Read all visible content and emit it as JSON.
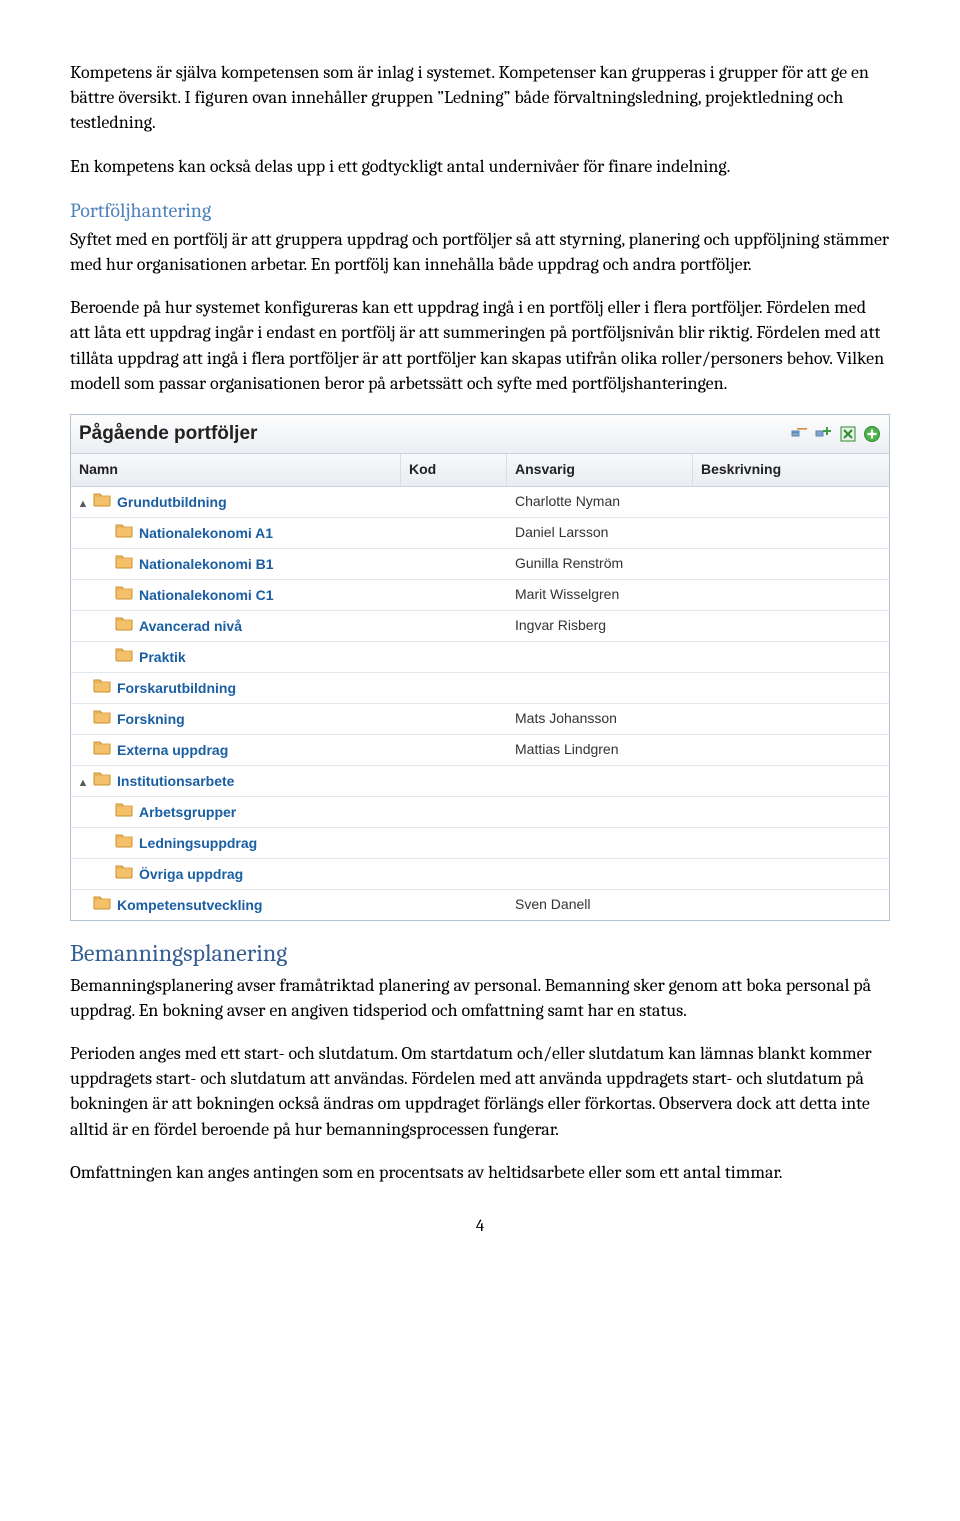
{
  "paragraphs": {
    "intro1": "Kompetens är själva kompetensen som är inlag i systemet. Kompetenser kan grupperas i grupper för att ge en bättre översikt. I figuren ovan innehåller gruppen ”Ledning” både förvaltningsledning, projektledning och testledning.",
    "intro2": "En kompetens kan också delas upp i ett godtyckligt antal undernivåer för finare indelning.",
    "portf1": "Syftet med en portfölj är att gruppera uppdrag och portföljer så att styrning, planering och uppföljning stämmer med hur organisationen arbetar. En portfölj kan innehålla både uppdrag och andra portföljer.",
    "portf2": "Beroende på hur systemet konfigureras kan ett uppdrag ingå i en portfölj eller i flera portföljer. Fördelen med att låta ett uppdrag ingår i endast en portfölj är att summeringen på portföljsnivån blir riktig. Fördelen med att tillåta uppdrag att ingå i flera portföljer är att portföljer kan skapas utifrån olika roller/personers behov. Vilken modell som passar organisationen beror på arbetssätt och syfte med portföljshanteringen.",
    "beman1": "Bemanningsplanering avser framåtriktad planering av personal. Bemanning sker genom att boka personal på uppdrag. En bokning avser en angiven tidsperiod och omfattning samt har en status.",
    "beman2": "Perioden anges med ett start- och slutdatum. Om startdatum och/eller slutdatum kan lämnas blankt kommer uppdragets start- och slutdatum att användas. Fördelen med att använda uppdragets start- och slutdatum på bokningen är att bokningen också ändras om uppdraget förlängs eller förkortas. Observera dock att detta inte alltid är en fördel beroende på hur bemanningsprocessen fungerar.",
    "beman3": "Omfattningen kan anges antingen som en procentsats av heltidsarbete eller som ett antal timmar."
  },
  "headings": {
    "portf": "Portföljhantering",
    "beman": "Bemanningsplanering"
  },
  "widget": {
    "title": "Pågående portföljer",
    "columns": {
      "name": "Namn",
      "kod": "Kod",
      "ansv": "Ansvarig",
      "besk": "Beskrivning"
    },
    "rows": [
      {
        "indent": 0,
        "toggle": "▲",
        "label": "Grundutbildning",
        "ansv": "Charlotte Nyman"
      },
      {
        "indent": 1,
        "toggle": "",
        "label": "Nationalekonomi A1",
        "ansv": "Daniel Larsson"
      },
      {
        "indent": 1,
        "toggle": "",
        "label": "Nationalekonomi B1",
        "ansv": "Gunilla Renström"
      },
      {
        "indent": 1,
        "toggle": "",
        "label": "Nationalekonomi C1",
        "ansv": "Marit Wisselgren"
      },
      {
        "indent": 1,
        "toggle": "",
        "label": "Avancerad nivå",
        "ansv": "Ingvar Risberg"
      },
      {
        "indent": 1,
        "toggle": "",
        "label": "Praktik",
        "ansv": ""
      },
      {
        "indent": 0,
        "toggle": "",
        "label": "Forskarutbildning",
        "ansv": ""
      },
      {
        "indent": 0,
        "toggle": "",
        "label": "Forskning",
        "ansv": "Mats Johansson"
      },
      {
        "indent": 0,
        "toggle": "",
        "label": "Externa uppdrag",
        "ansv": "Mattias Lindgren"
      },
      {
        "indent": 0,
        "toggle": "▲",
        "label": "Institutionsarbete",
        "ansv": ""
      },
      {
        "indent": 1,
        "toggle": "",
        "label": "Arbetsgrupper",
        "ansv": ""
      },
      {
        "indent": 1,
        "toggle": "",
        "label": "Ledningsuppdrag",
        "ansv": ""
      },
      {
        "indent": 1,
        "toggle": "",
        "label": "Övriga uppdrag",
        "ansv": ""
      },
      {
        "indent": 0,
        "toggle": "",
        "label": "Kompetensutveckling",
        "ansv": "Sven Danell"
      }
    ]
  },
  "pageNumber": "4"
}
